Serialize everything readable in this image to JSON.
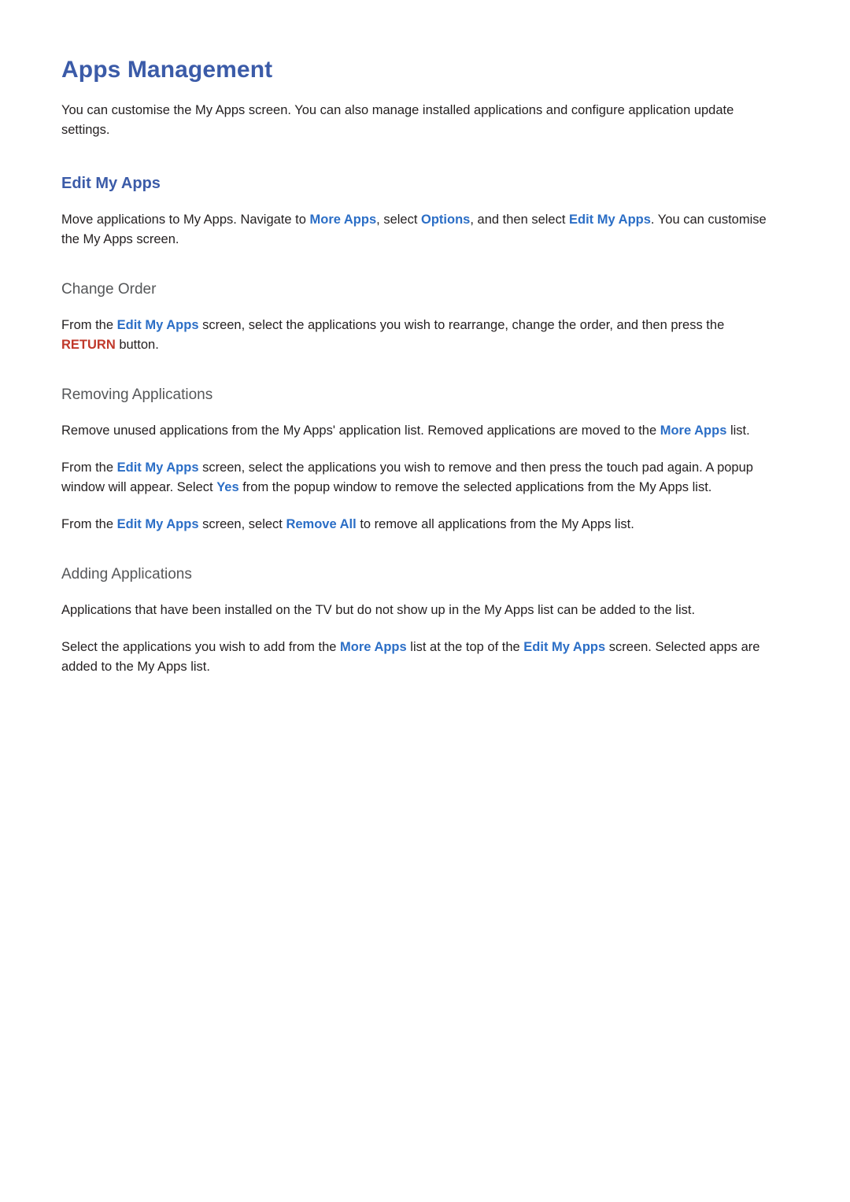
{
  "document": {
    "title": "Apps Management",
    "intro": "You can customise the My Apps screen. You can also manage installed applications and configure application update settings.",
    "sections": [
      {
        "id": "edit-my-apps",
        "heading": "Edit My Apps",
        "paragraphs": [
          {
            "id": "edit-my-apps-p1",
            "parts": [
              {
                "text": "Move applications to My Apps. Navigate to ",
                "style": "plain"
              },
              {
                "text": "More Apps",
                "style": "link"
              },
              {
                "text": ", select ",
                "style": "plain"
              },
              {
                "text": "Options",
                "style": "link"
              },
              {
                "text": ", and then select ",
                "style": "plain"
              },
              {
                "text": "Edit My Apps",
                "style": "link"
              },
              {
                "text": ". You can customise the My Apps screen.",
                "style": "plain"
              }
            ]
          }
        ],
        "subsections": [
          {
            "id": "change-order",
            "heading": "Change Order",
            "paragraphs": [
              {
                "id": "change-order-p1",
                "parts": [
                  {
                    "text": "From the ",
                    "style": "plain"
                  },
                  {
                    "text": "Edit My Apps",
                    "style": "link"
                  },
                  {
                    "text": " screen, select the applications you wish to rearrange, change the order, and then press the ",
                    "style": "plain"
                  },
                  {
                    "text": "RETURN",
                    "style": "red"
                  },
                  {
                    "text": " button.",
                    "style": "plain"
                  }
                ]
              }
            ]
          },
          {
            "id": "removing-applications",
            "heading": "Removing Applications",
            "paragraphs": [
              {
                "id": "removing-p1",
                "parts": [
                  {
                    "text": "Remove unused applications from the My Apps' application list. Removed applications are moved to the ",
                    "style": "plain"
                  },
                  {
                    "text": "More Apps",
                    "style": "link"
                  },
                  {
                    "text": " list.",
                    "style": "plain"
                  }
                ]
              },
              {
                "id": "removing-p2",
                "parts": [
                  {
                    "text": "From the ",
                    "style": "plain"
                  },
                  {
                    "text": "Edit My Apps",
                    "style": "link"
                  },
                  {
                    "text": " screen, select the applications you wish to remove and then press the touch pad again. A popup window will appear. Select ",
                    "style": "plain"
                  },
                  {
                    "text": "Yes",
                    "style": "link"
                  },
                  {
                    "text": " from the popup window to remove the selected applications from the My Apps list.",
                    "style": "plain"
                  }
                ]
              },
              {
                "id": "removing-p3",
                "parts": [
                  {
                    "text": "From the ",
                    "style": "plain"
                  },
                  {
                    "text": "Edit My Apps",
                    "style": "link"
                  },
                  {
                    "text": " screen, select ",
                    "style": "plain"
                  },
                  {
                    "text": "Remove All",
                    "style": "link"
                  },
                  {
                    "text": " to remove all applications from the My Apps list.",
                    "style": "plain"
                  }
                ]
              }
            ]
          },
          {
            "id": "adding-applications",
            "heading": "Adding Applications",
            "paragraphs": [
              {
                "id": "adding-p1",
                "parts": [
                  {
                    "text": "Applications that have been installed on the TV but do not show up in the My Apps list can be added to the list.",
                    "style": "plain"
                  }
                ]
              },
              {
                "id": "adding-p2",
                "parts": [
                  {
                    "text": "Select the applications you wish to add from the ",
                    "style": "plain"
                  },
                  {
                    "text": "More Apps",
                    "style": "link"
                  },
                  {
                    "text": " list at the top of the ",
                    "style": "plain"
                  },
                  {
                    "text": "Edit My Apps",
                    "style": "link"
                  },
                  {
                    "text": " screen. Selected apps are added to the My Apps list.",
                    "style": "plain"
                  }
                ]
              }
            ]
          }
        ]
      }
    ],
    "colors": {
      "heading_blue": "#3b5ba8",
      "link_blue": "#2b6ec6",
      "red": "#c0392b",
      "body": "#231f20",
      "subheading_gray": "#555759"
    }
  }
}
